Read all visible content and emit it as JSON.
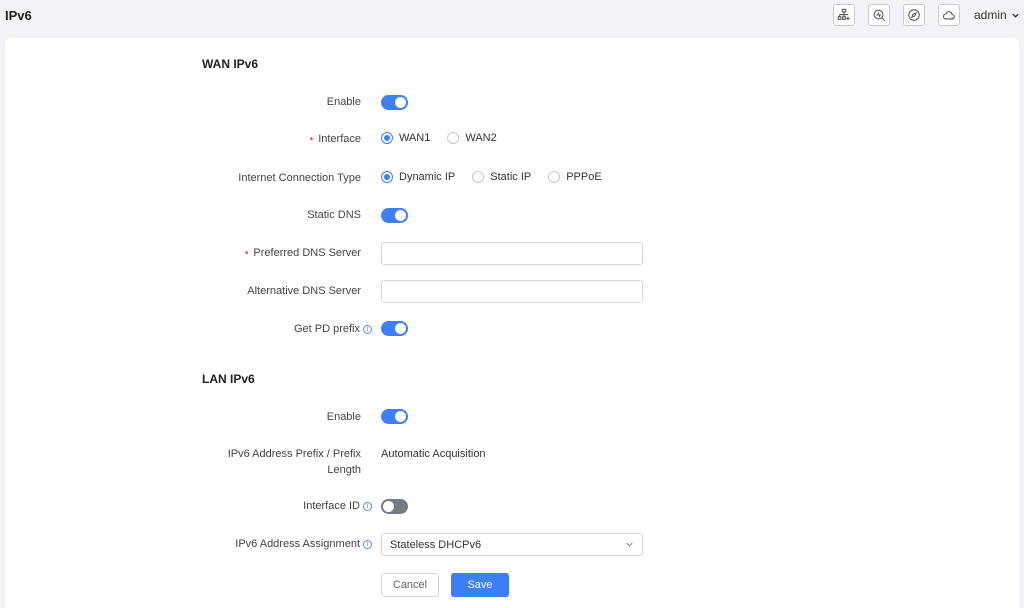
{
  "header": {
    "title": "IPv6",
    "icons": [
      "network-add-icon",
      "diagnose-icon",
      "compass-icon",
      "cloud-icon"
    ],
    "user": "admin"
  },
  "wan": {
    "section_title": "WAN IPv6",
    "enable_label": "Enable",
    "enable_value": true,
    "interface_label": "Interface",
    "interface_options": [
      "WAN1",
      "WAN2"
    ],
    "interface_selected": "WAN1",
    "conn_type_label": "Internet Connection Type",
    "conn_type_options": [
      "Dynamic IP",
      "Static IP",
      "PPPoE"
    ],
    "conn_type_selected": "Dynamic IP",
    "static_dns_label": "Static DNS",
    "static_dns_value": true,
    "preferred_dns_label": "Preferred DNS Server",
    "preferred_dns_value": "",
    "alternative_dns_label": "Alternative DNS Server",
    "alternative_dns_value": "",
    "pd_prefix_label": "Get PD prefix",
    "pd_prefix_value": true
  },
  "lan": {
    "section_title": "LAN IPv6",
    "enable_label": "Enable",
    "enable_value": true,
    "prefix_label_line1": "IPv6 Address Prefix / Prefix",
    "prefix_label_line2": "Length",
    "prefix_value": "Automatic Acquisition",
    "interface_id_label": "Interface ID",
    "interface_id_value": false,
    "assignment_label": "IPv6 Address Assignment",
    "assignment_value": "Stateless DHCPv6"
  },
  "actions": {
    "cancel_label": "Cancel",
    "save_label": "Save"
  },
  "colors": {
    "accent": "#3d7ff5",
    "required": "#e5484d",
    "toggle_off": "#747b85"
  }
}
